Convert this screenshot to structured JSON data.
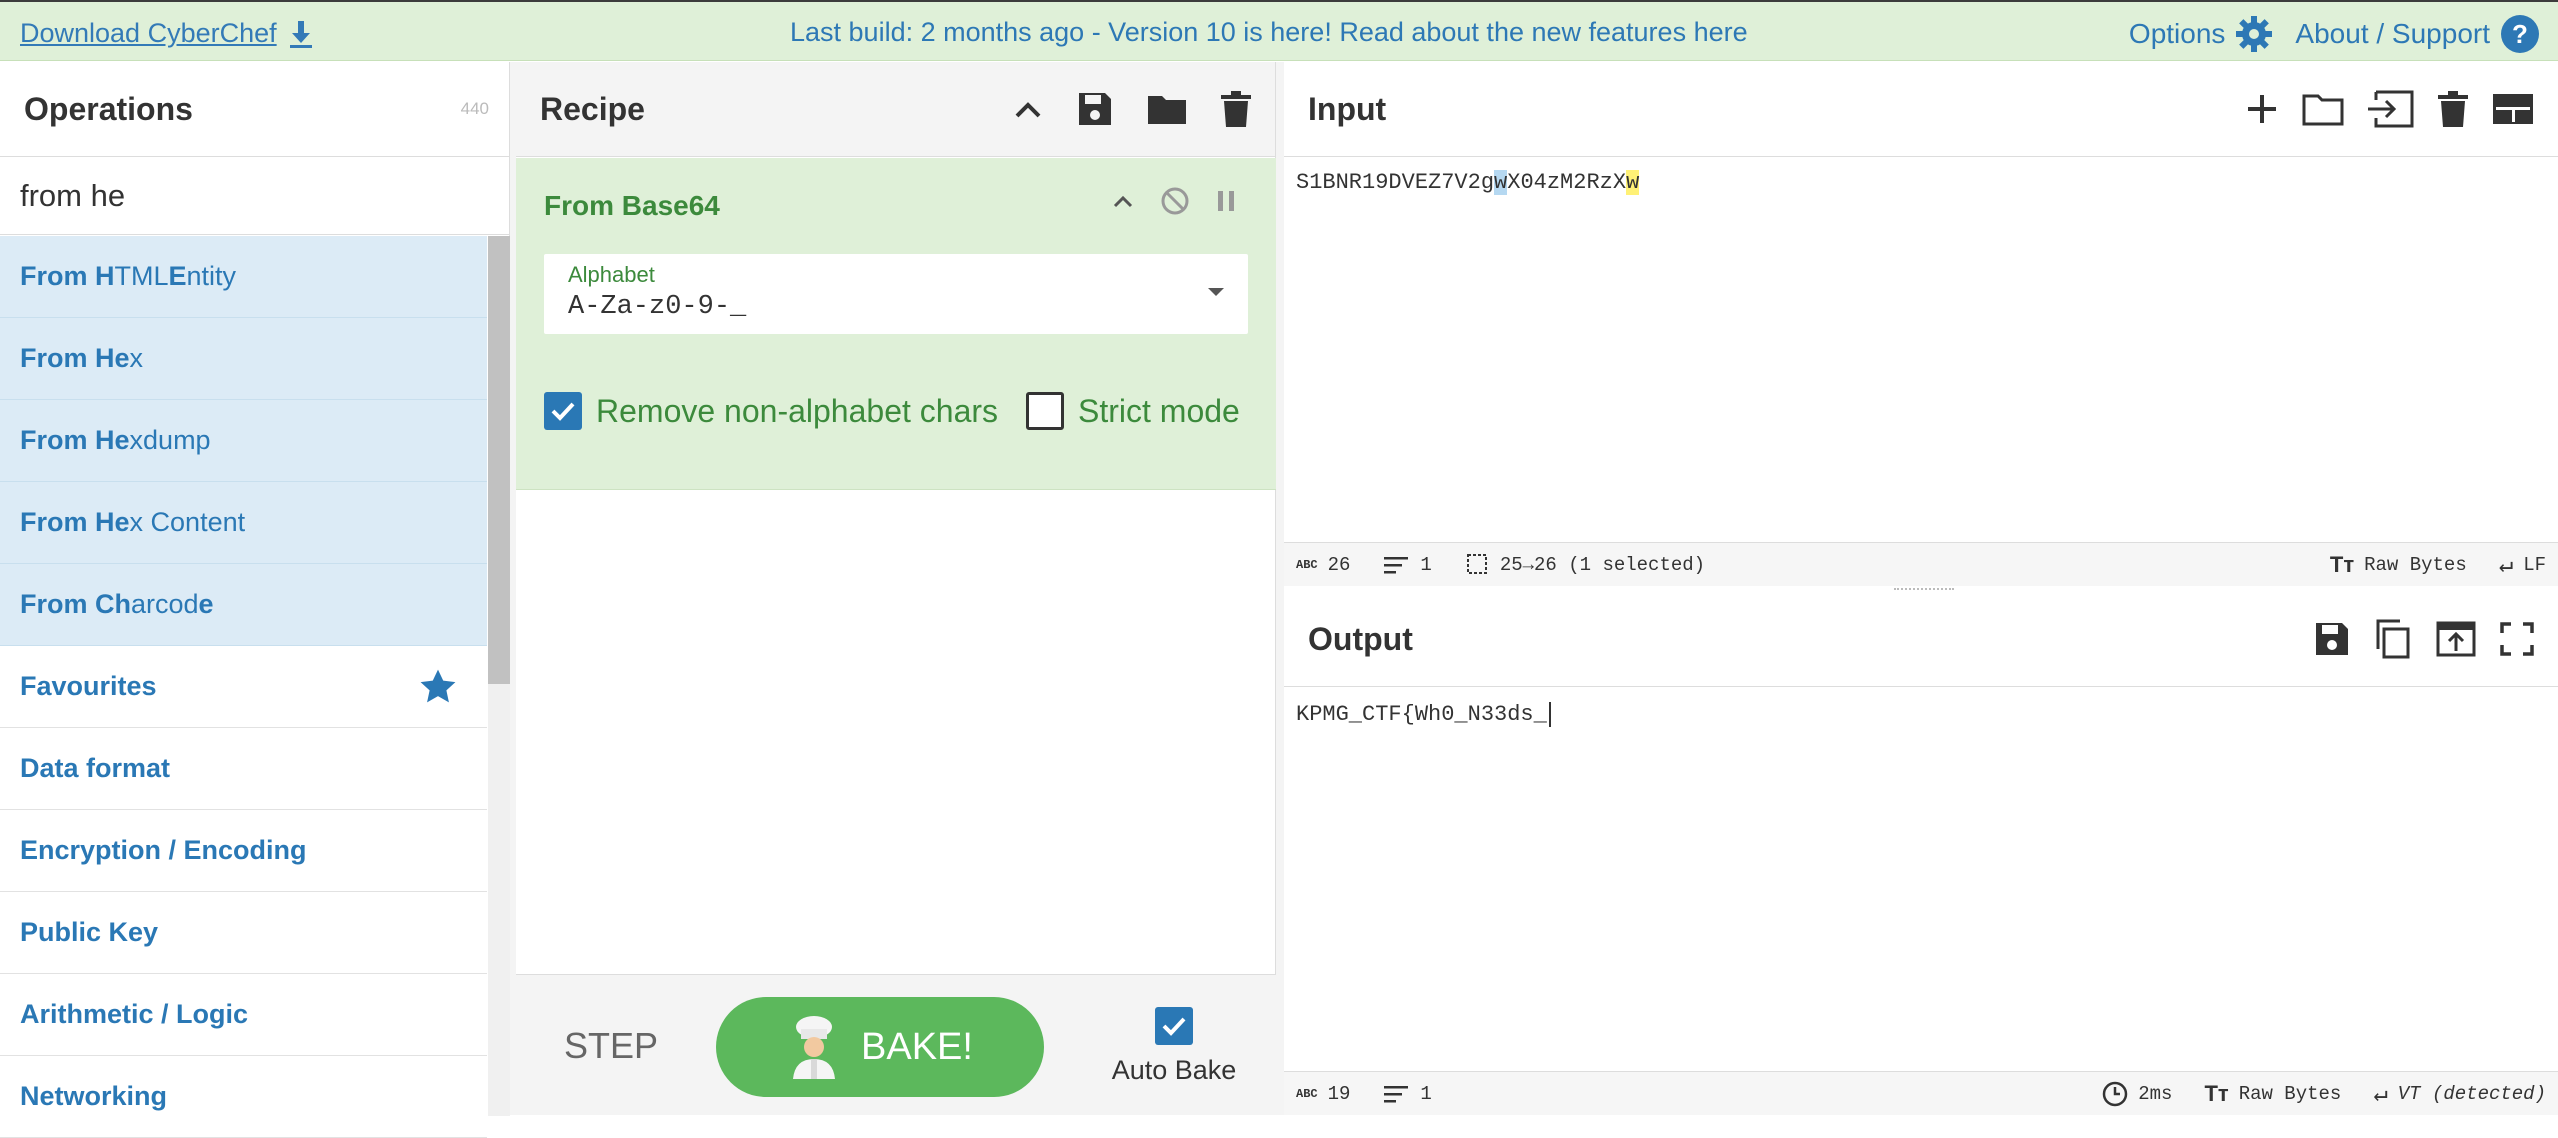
{
  "topbar": {
    "download_label": "Download CyberChef",
    "banner": "Last build: 2 months ago - Version 10 is here! Read about the new features here",
    "options_label": "Options",
    "about_label": "About / Support"
  },
  "operations": {
    "title": "Operations",
    "count": "440",
    "search_value": "from he",
    "results": [
      {
        "parts": [
          [
            "From H",
            true
          ],
          [
            "TML ",
            false
          ],
          [
            "E",
            true
          ],
          [
            "ntity",
            false
          ]
        ]
      },
      {
        "parts": [
          [
            "From He",
            true
          ],
          [
            "x",
            false
          ]
        ]
      },
      {
        "parts": [
          [
            "From He",
            true
          ],
          [
            "xdump",
            false
          ]
        ]
      },
      {
        "parts": [
          [
            "From He",
            true
          ],
          [
            "x Content",
            false
          ]
        ]
      },
      {
        "parts": [
          [
            "From Ch",
            true
          ],
          [
            "arcod",
            false
          ],
          [
            "e",
            true
          ]
        ]
      }
    ],
    "categories": [
      "Favourites",
      "Data format",
      "Encryption / Encoding",
      "Public Key",
      "Arithmetic / Logic",
      "Networking"
    ]
  },
  "recipe": {
    "title": "Recipe",
    "ingredient": {
      "name": "From Base64",
      "alphabet_label": "Alphabet",
      "alphabet_value": "A-Za-z0-9-_",
      "remove_nonalpha_label": "Remove non-alphabet chars",
      "strict_mode_label": "Strict mode"
    },
    "step_label": "STEP",
    "bake_label": "BAKE!",
    "autobake_label": "Auto Bake"
  },
  "input": {
    "title": "Input",
    "text_before": "S1BNR19DVEZ7V2g",
    "text_sel": "w",
    "text_mid": "X04zM2RzX",
    "text_cursor": "w",
    "status_chars": "26",
    "status_lines": "1",
    "status_selection": "25→26 (1 selected)",
    "status_encoding": "Raw Bytes",
    "status_eol": "LF"
  },
  "output": {
    "title": "Output",
    "text": "KPMG_CTF{Wh0_N33ds_",
    "status_chars": "19",
    "status_lines": "1",
    "status_time": "2ms",
    "status_encoding": "Raw Bytes",
    "status_eol": "VT (detected)"
  },
  "colors": {
    "accent": "#2a78b5",
    "green": "#5cb85c",
    "ingredient_bg": "#dff0d8",
    "op_bg": "#dcebf6"
  }
}
